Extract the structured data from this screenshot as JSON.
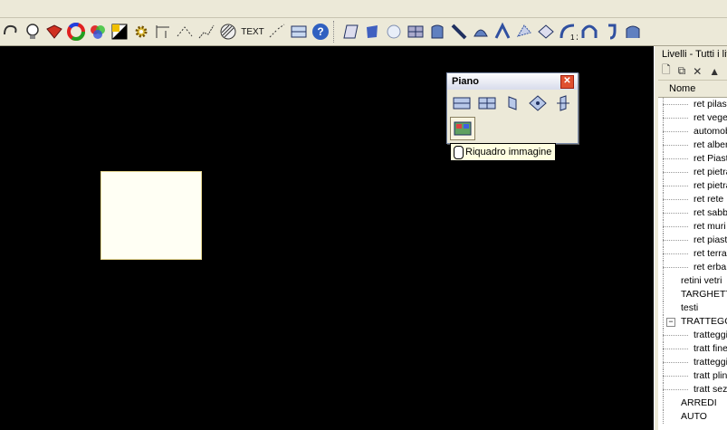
{
  "toolbar": {
    "text_button_label": "TEXT"
  },
  "palette": {
    "title": "Piano",
    "tooltip": "Riquadro immagine"
  },
  "layers_panel": {
    "title": "Livelli - Tutti i livelli",
    "column_name": "Nome",
    "items": [
      {
        "label": "ret pilastri",
        "indent": 1
      },
      {
        "label": "ret vegetazione",
        "indent": 1
      },
      {
        "label": "automobili",
        "indent": 1
      },
      {
        "label": "ret alberi",
        "indent": 1
      },
      {
        "label": "ret Piastrelle",
        "indent": 1
      },
      {
        "label": "ret pietra",
        "indent": 1
      },
      {
        "label": "ret pietra",
        "indent": 1
      },
      {
        "label": "ret rete",
        "indent": 1
      },
      {
        "label": "ret sabbia",
        "indent": 1
      },
      {
        "label": "ret muri",
        "indent": 1
      },
      {
        "label": "ret piastrelle",
        "indent": 1
      },
      {
        "label": "ret terra",
        "indent": 1
      },
      {
        "label": "ret erba",
        "indent": 1
      },
      {
        "label": "retini vetri",
        "indent": 0
      },
      {
        "label": "TARGHETTE",
        "indent": 0
      },
      {
        "label": "testi",
        "indent": 0
      },
      {
        "label": "TRATTEGGI",
        "indent": 0,
        "expander": "−"
      },
      {
        "label": "tratteggi",
        "indent": 1
      },
      {
        "label": "tratt fine",
        "indent": 1
      },
      {
        "label": "tratteggi",
        "indent": 1
      },
      {
        "label": "tratt plinti",
        "indent": 1
      },
      {
        "label": "tratt sezione",
        "indent": 1
      },
      {
        "label": "ARREDI",
        "indent": 0
      },
      {
        "label": "AUTO",
        "indent": 0
      }
    ]
  }
}
